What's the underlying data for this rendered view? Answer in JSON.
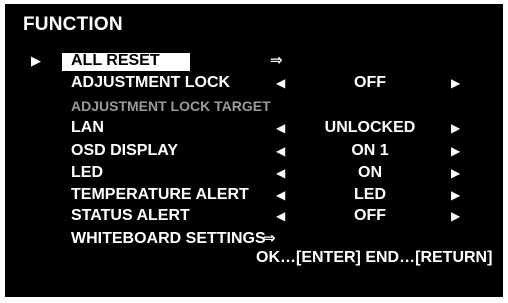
{
  "menu": {
    "title": "FUNCTION",
    "cursor_glyph": "▶",
    "left_arrow": "◀",
    "right_arrow": "▶",
    "go_arrow": "⇒",
    "items": [
      {
        "label": "ALL RESET",
        "selected": true,
        "action": "⇒"
      },
      {
        "label": "ADJUSTMENT LOCK",
        "value": "OFF"
      },
      {
        "label": "ADJUSTMENT LOCK TARGET",
        "disabled": true
      },
      {
        "label": "LAN",
        "value": "UNLOCKED"
      },
      {
        "label": "OSD DISPLAY",
        "value": "ON 1"
      },
      {
        "label": "LED",
        "value": "ON"
      },
      {
        "label": "TEMPERATURE ALERT",
        "value": "LED"
      },
      {
        "label": "STATUS ALERT",
        "value": "OFF"
      },
      {
        "label": "WHITEBOARD SETTINGS",
        "action": "⇒"
      }
    ],
    "footer": "OK…[ENTER]  END…[RETURN]"
  },
  "colors": {
    "background": "#000000",
    "text": "#ffffff",
    "disabled_text": "#9a9a9a",
    "selection": "#ffffff"
  }
}
